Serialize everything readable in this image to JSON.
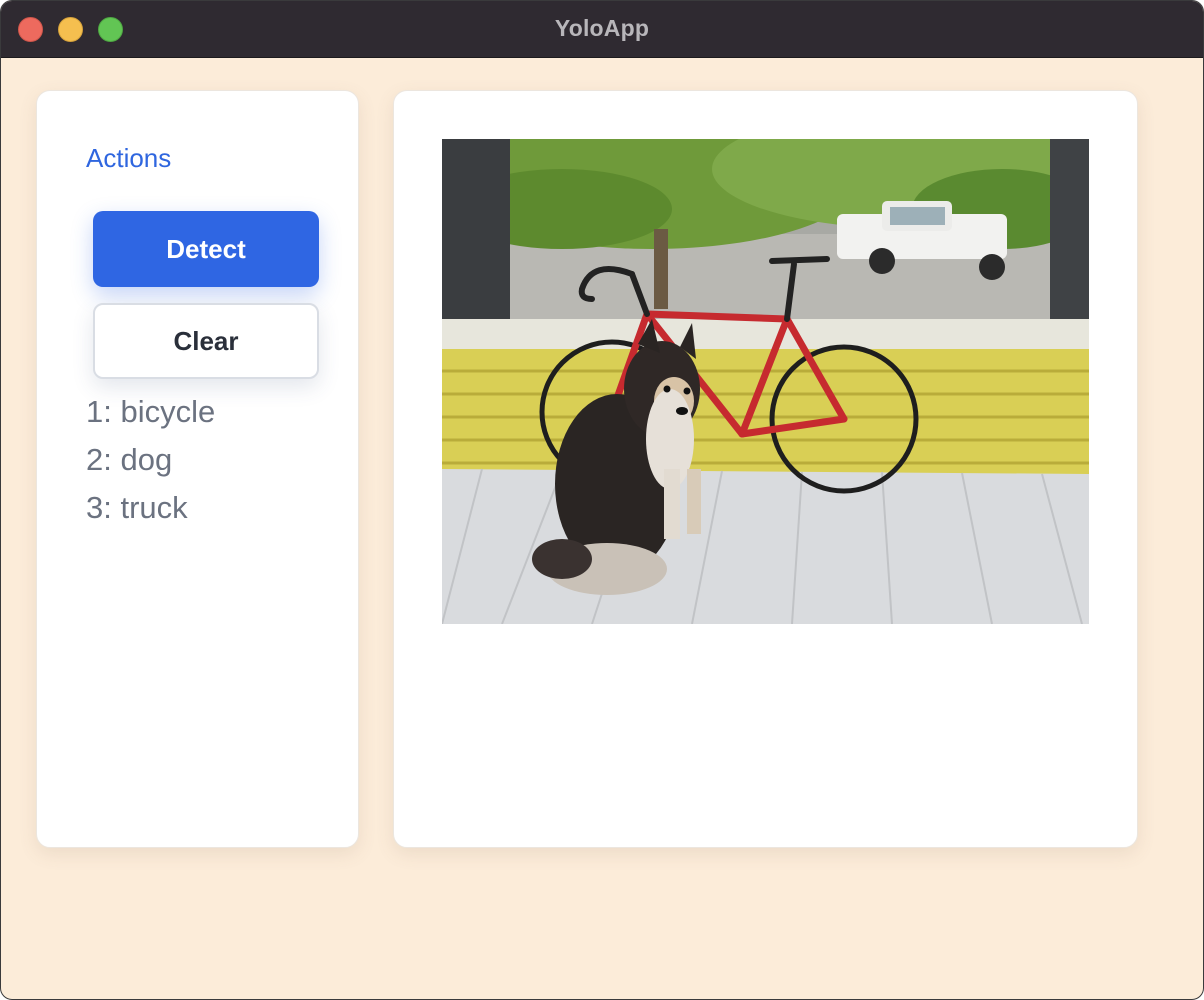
{
  "window": {
    "title": "YoloApp",
    "controls": [
      "close",
      "minimize",
      "maximize"
    ]
  },
  "sidebar": {
    "section_title": "Actions",
    "detect_label": "Detect",
    "clear_label": "Clear",
    "results": [
      "1: bicycle",
      "2: dog",
      "3: truck"
    ]
  },
  "main": {
    "image_subject": "dog and bicycle on porch"
  },
  "colors": {
    "window_background": "#fcecd9",
    "accent": "#2f66e3",
    "titlebar": "#2f2a31",
    "result_text": "#6b7280"
  }
}
